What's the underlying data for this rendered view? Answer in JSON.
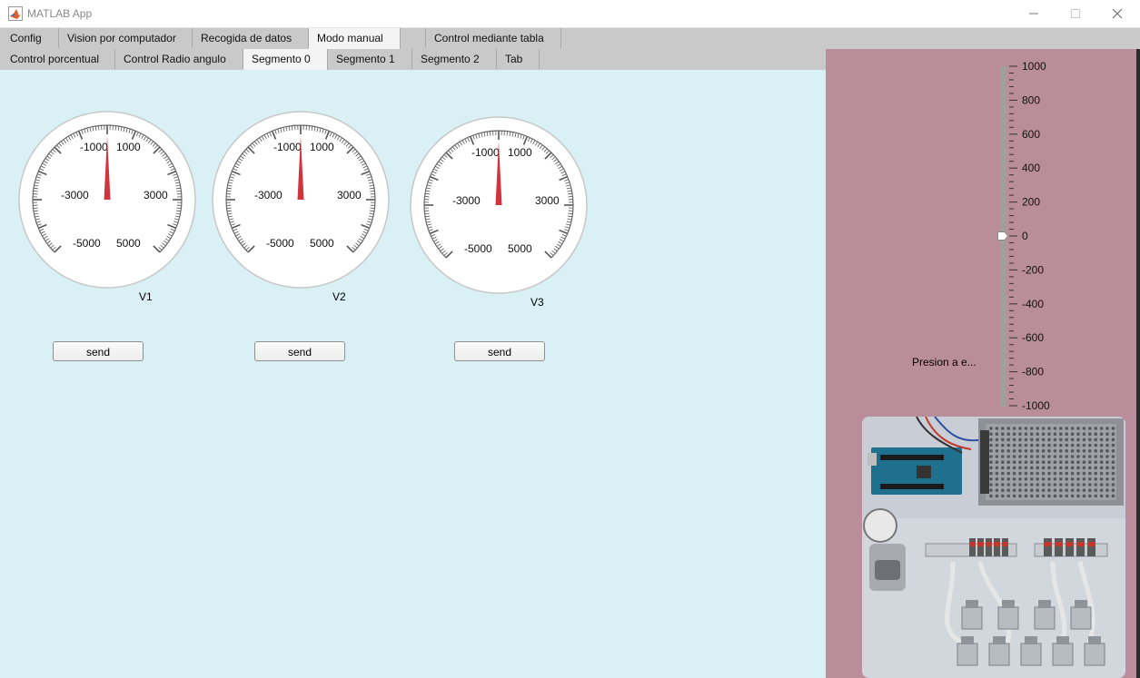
{
  "window": {
    "title": "MATLAB App",
    "controls": {
      "minimize": "—",
      "maximize": "☐",
      "close": "✕"
    }
  },
  "tabs_top": [
    {
      "label": "Config"
    },
    {
      "label": "Vision por computador"
    },
    {
      "label": "Recogida de datos"
    },
    {
      "label": "Modo manual",
      "active": true
    },
    {
      "label": ""
    },
    {
      "label": "Control mediante tabla"
    }
  ],
  "tabs_sub": [
    {
      "label": "Control porcentual"
    },
    {
      "label": "Control Radio angulo"
    },
    {
      "label": "Segmento 0",
      "active": true
    },
    {
      "label": "Segmento 1"
    },
    {
      "label": "Segmento 2"
    },
    {
      "label": "Tab"
    }
  ],
  "gauges": [
    {
      "label": "V1",
      "value": 0,
      "min": -6000,
      "max": 6000,
      "ticks": [
        "-5000",
        "-3000",
        "-1000",
        "1000",
        "3000",
        "5000"
      ]
    },
    {
      "label": "V2",
      "value": 0,
      "min": -6000,
      "max": 6000,
      "ticks": [
        "-5000",
        "-3000",
        "-1000",
        "1000",
        "3000",
        "5000"
      ]
    },
    {
      "label": "V3",
      "value": 0,
      "min": -6000,
      "max": 6000,
      "ticks": [
        "-5000",
        "-3000",
        "-1000",
        "1000",
        "3000",
        "5000"
      ]
    }
  ],
  "buttons": {
    "send_label": "send"
  },
  "pressure_slider": {
    "label": "Presion a e...",
    "value": 0,
    "min": -1000,
    "max": 1000,
    "ticks": [
      "1000",
      "800",
      "600",
      "400",
      "200",
      "0",
      "-200",
      "-400",
      "-600",
      "-800",
      "-1000"
    ]
  },
  "colors": {
    "main_bg": "#d9f0f4",
    "side_bg": "#b98d99",
    "needle": "#d0343c",
    "tab_bg": "#c9c9c9",
    "tab_active": "#f4f4f4"
  }
}
